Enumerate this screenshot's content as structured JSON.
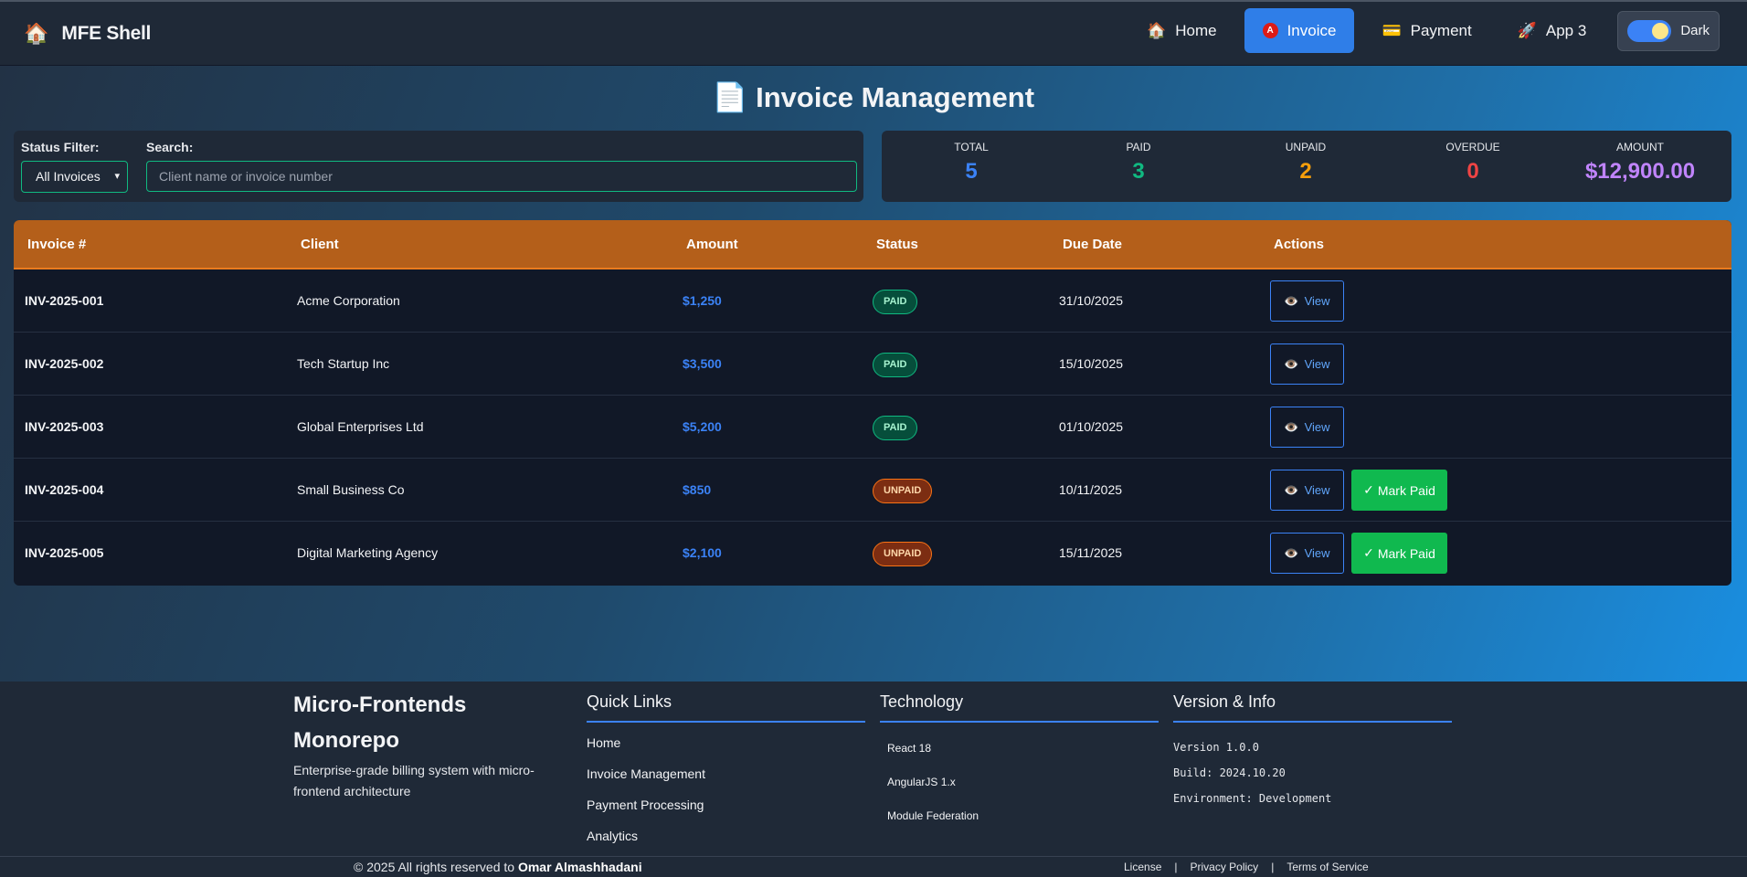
{
  "navbar": {
    "brand_icon": "house-icon",
    "brand": "MFE Shell",
    "items": [
      {
        "label": "Home",
        "icon": "🏠"
      },
      {
        "label": "Invoice",
        "icon": "A",
        "active": true
      },
      {
        "label": "Payment",
        "icon": "💳"
      },
      {
        "label": "App 3",
        "icon": "🚀"
      }
    ],
    "theme_label": "Dark",
    "theme_on": true
  },
  "page": {
    "title": "📄 Invoice Management"
  },
  "filters": {
    "status_label": "Status Filter:",
    "status_value": "All Invoices",
    "search_label": "Search:",
    "search_placeholder": "Client name or invoice number"
  },
  "stats": [
    {
      "label": "TOTAL",
      "value": "5",
      "color": "#3b82f6"
    },
    {
      "label": "PAID",
      "value": "3",
      "color": "#10b981"
    },
    {
      "label": "UNPAID",
      "value": "2",
      "color": "#f59e0b"
    },
    {
      "label": "OVERDUE",
      "value": "0",
      "color": "#ef4444"
    },
    {
      "label": "AMOUNT",
      "value": "$12,900.00",
      "color": "#c084fc"
    }
  ],
  "table": {
    "headers": [
      "Invoice #",
      "Client",
      "Amount",
      "Status",
      "Due Date",
      "Actions"
    ],
    "view_label": "View",
    "mark_paid_label": "Mark Paid",
    "rows": [
      {
        "number": "INV-2025-001",
        "client": "Acme Corporation",
        "amount": "$1,250",
        "status": "PAID",
        "due": "31/10/2025"
      },
      {
        "number": "INV-2025-002",
        "client": "Tech Startup Inc",
        "amount": "$3,500",
        "status": "PAID",
        "due": "15/10/2025"
      },
      {
        "number": "INV-2025-003",
        "client": "Global Enterprises Ltd",
        "amount": "$5,200",
        "status": "PAID",
        "due": "01/10/2025"
      },
      {
        "number": "INV-2025-004",
        "client": "Small Business Co",
        "amount": "$850",
        "status": "UNPAID",
        "due": "10/11/2025"
      },
      {
        "number": "INV-2025-005",
        "client": "Digital Marketing Agency",
        "amount": "$2,100",
        "status": "UNPAID",
        "due": "15/11/2025"
      }
    ]
  },
  "footer": {
    "brand_title_1": "Micro-Frontends",
    "brand_title_2": "Monorepo",
    "brand_desc": "Enterprise-grade billing system with micro-frontend architecture",
    "quick_links_title": "Quick Links",
    "quick_links": [
      "Home",
      "Invoice Management",
      "Payment Processing",
      "Analytics"
    ],
    "technology_title": "Technology",
    "technology": [
      "React 18",
      "AngularJS 1.x",
      "Module Federation"
    ],
    "version_title": "Version & Info",
    "version_lines": [
      "Version 1.0.0",
      "Build: 2024.10.20",
      "Environment: Development"
    ],
    "copyright_prefix": "© 2025 All rights reserved to",
    "copyright_owner": "Omar Almashhadani",
    "legal": [
      "License",
      "|",
      "Privacy Policy",
      "|",
      "Terms of Service"
    ]
  }
}
